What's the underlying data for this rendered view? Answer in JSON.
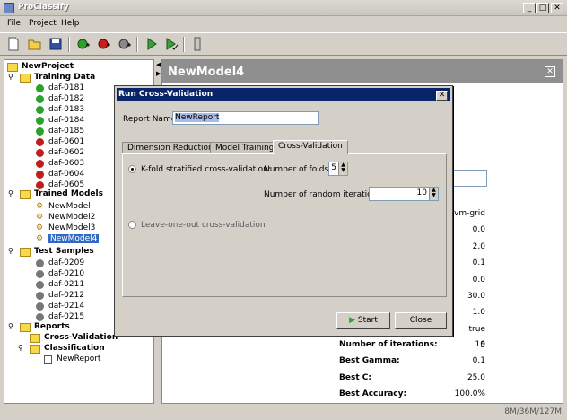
{
  "window": {
    "title": "ProClassify"
  },
  "menu": [
    "File",
    "Project",
    "Help"
  ],
  "toolbar": {
    "icons": [
      "new-icon",
      "open-icon",
      "save-icon",
      "add-green-icon",
      "add-red-icon",
      "add-gray-icon",
      "run-icon",
      "run-check-icon",
      "dataset-icon"
    ]
  },
  "tree": {
    "project": "NewProject",
    "training_data": {
      "label": "Training Data",
      "items": [
        {
          "label": "daf-0181",
          "color": "green"
        },
        {
          "label": "daf-0182",
          "color": "green"
        },
        {
          "label": "daf-0183",
          "color": "green"
        },
        {
          "label": "daf-0184",
          "color": "green"
        },
        {
          "label": "daf-0185",
          "color": "green"
        },
        {
          "label": "daf-0601",
          "color": "red"
        },
        {
          "label": "daf-0602",
          "color": "red"
        },
        {
          "label": "daf-0603",
          "color": "red"
        },
        {
          "label": "daf-0604",
          "color": "red"
        },
        {
          "label": "daf-0605",
          "color": "red"
        }
      ]
    },
    "trained_models": {
      "label": "Trained Models",
      "items": [
        "NewModel",
        "NewModel2",
        "NewModel3",
        "NewModel4"
      ],
      "selected": "NewModel4"
    },
    "test_samples": {
      "label": "Test Samples",
      "items": [
        "daf-0209",
        "daf-0210",
        "daf-0211",
        "daf-0212",
        "daf-0214",
        "daf-0215"
      ]
    },
    "reports": {
      "label": "Reports",
      "cross_validation": "Cross-Validation",
      "classification": "Classification",
      "report": "NewReport"
    }
  },
  "model_panel": {
    "title": "NewModel4",
    "values": [
      "svm-grid",
      "0.0",
      "2.0",
      "0.1",
      "0.0",
      "30.0",
      "1.0",
      "true",
      "5"
    ],
    "results": [
      {
        "label": "Number of iterations:",
        "value": "10"
      },
      {
        "label": "Best Gamma:",
        "value": "0.1"
      },
      {
        "label": "Best C:",
        "value": "25.0"
      },
      {
        "label": "Best Accuracy:",
        "value": "100.0%"
      }
    ]
  },
  "status": "8M/36M/127M",
  "dialog": {
    "title": "Run Cross-Validation",
    "report_name_label": "Report Name:",
    "report_name_value": "NewReport",
    "tabs": [
      "Dimension Reduction",
      "Model Training",
      "Cross-Validation"
    ],
    "active_tab": "Cross-Validation",
    "kfold_label": "K-fold stratified cross-validation:",
    "folds_label": "Number of folds:",
    "folds_value": "5",
    "iterations_label": "Number of random iterations:",
    "iterations_value": "10",
    "loo_label": "Leave-one-out cross-validation",
    "start_label": "Start",
    "close_label": "Close"
  }
}
